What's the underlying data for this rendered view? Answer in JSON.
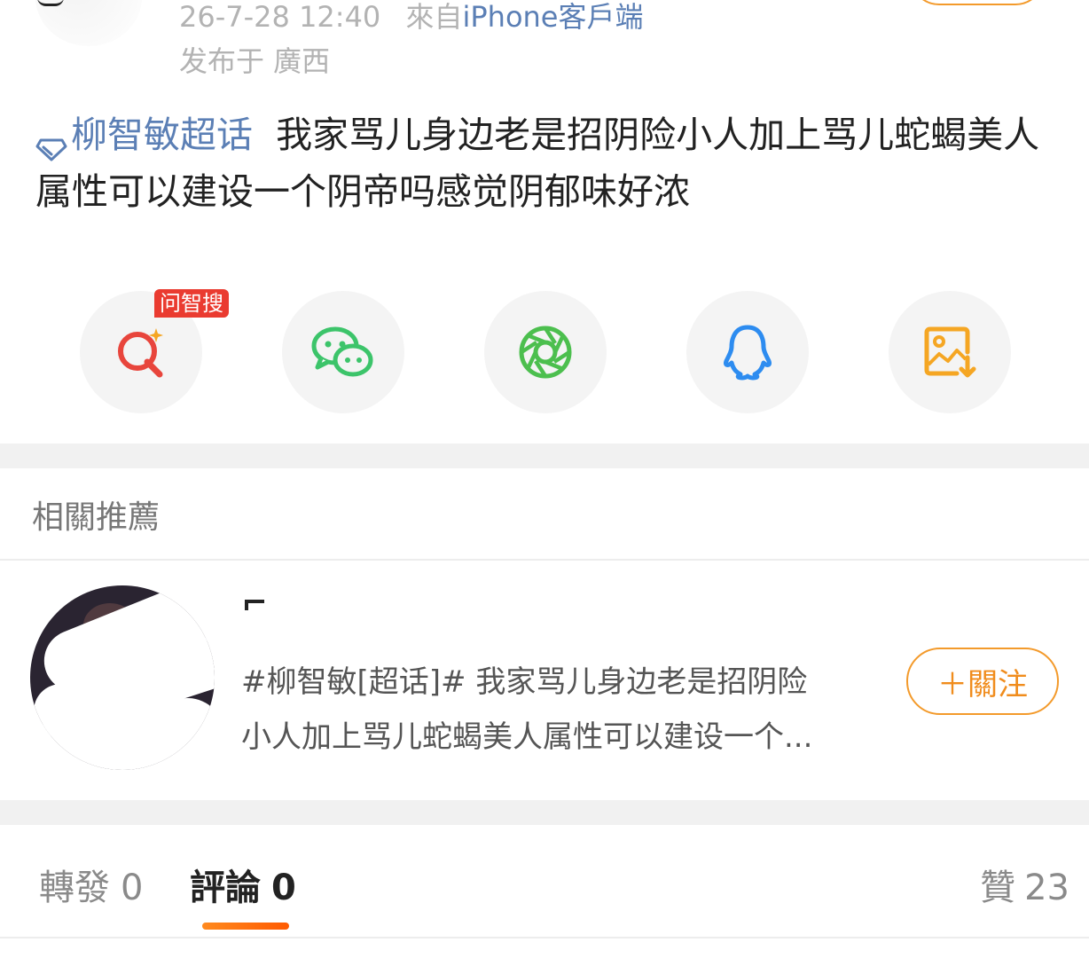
{
  "post": {
    "timestamp": "26-7-28 12:40",
    "source_prefix": "來自",
    "source_device": "iPhone客戶端",
    "location": "发布于 廣西",
    "topic": "柳智敏超话",
    "body": "我家骂儿身边老是招阴险小人加上骂儿蛇蝎美人属性可以建设一个阴帝吗感觉阴郁味好浓"
  },
  "share": {
    "badge": "问智搜",
    "buttons": [
      {
        "icon": "ai-search-icon",
        "color": "#e8453c"
      },
      {
        "icon": "wechat-icon",
        "color": "#3cc46a"
      },
      {
        "icon": "moments-icon",
        "color": "#4cbf4e"
      },
      {
        "icon": "qq-icon",
        "color": "#2d8cf0"
      },
      {
        "icon": "save-image-icon",
        "color": "#f5a623"
      }
    ]
  },
  "related": {
    "title": "相關推薦",
    "item": {
      "text_line1": "#柳智敏[超话]#  我家骂儿身边老是招阴险",
      "text_line2": "小人加上骂儿蛇蝎美人属性可以建设一个...",
      "follow_label": "＋關注"
    }
  },
  "tabs": {
    "repost": {
      "label": "轉發",
      "count": "0"
    },
    "comment": {
      "label": "評論",
      "count": "0"
    },
    "likes": {
      "label": "贊",
      "count": "23"
    }
  },
  "colors": {
    "accent": "#f39a2b",
    "link": "#5b7fb5",
    "badge": "#ea3b30"
  }
}
